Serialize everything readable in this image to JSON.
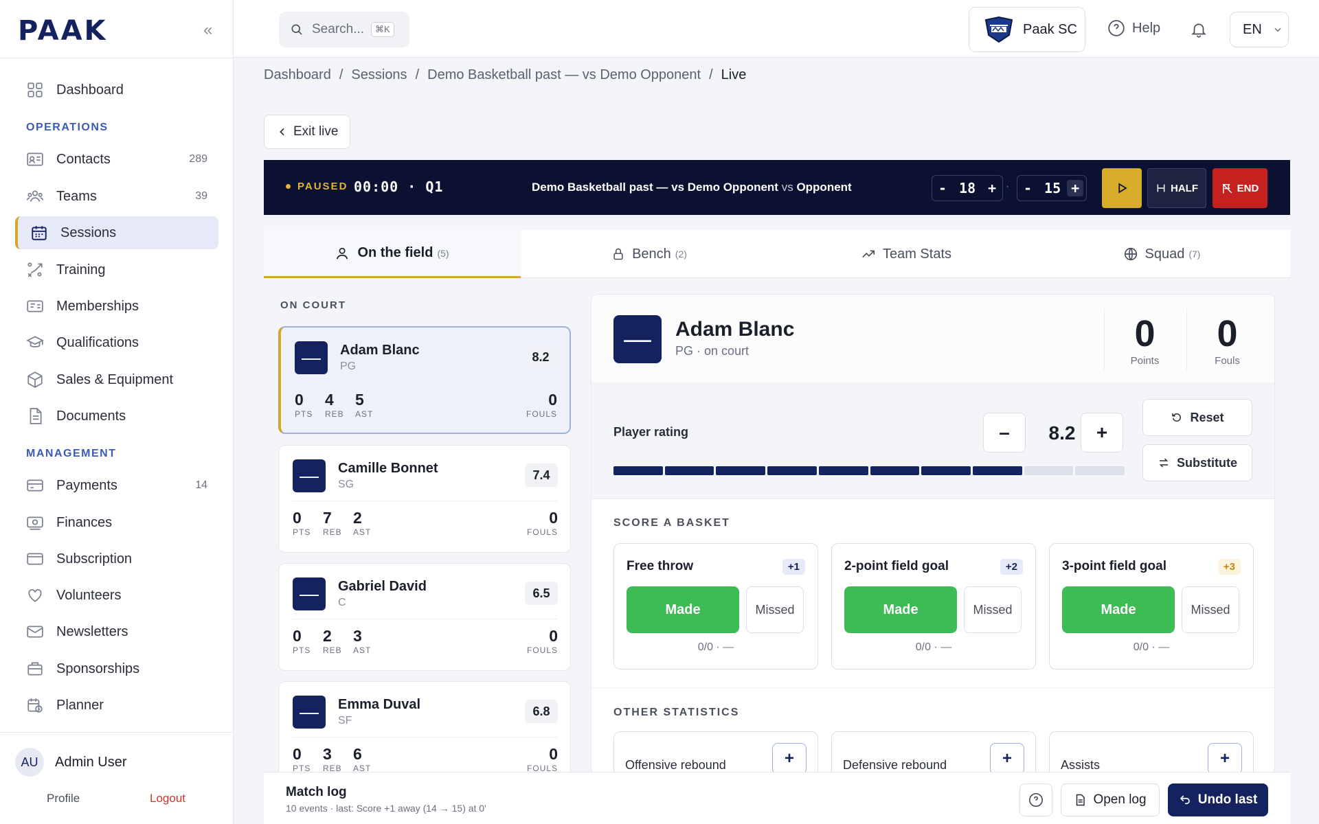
{
  "brand": {
    "logo": "PAAK",
    "accent": "#d6a52a",
    "navy": "#14235f"
  },
  "sidebar": {
    "collapse_label": "«",
    "items": [
      {
        "label": "Dashboard",
        "count": ""
      },
      {
        "label": "Contacts",
        "count": "289"
      },
      {
        "label": "Teams",
        "count": "39"
      },
      {
        "label": "Sessions",
        "count": ""
      },
      {
        "label": "Training",
        "count": ""
      },
      {
        "label": "Memberships",
        "count": ""
      },
      {
        "label": "Qualifications",
        "count": ""
      },
      {
        "label": "Sales & Equipment",
        "count": ""
      },
      {
        "label": "Documents",
        "count": ""
      },
      {
        "label": "Payments",
        "count": "14"
      },
      {
        "label": "Finances",
        "count": ""
      },
      {
        "label": "Subscription",
        "count": ""
      },
      {
        "label": "Volunteers",
        "count": ""
      },
      {
        "label": "Newsletters",
        "count": ""
      },
      {
        "label": "Sponsorships",
        "count": ""
      },
      {
        "label": "Planner",
        "count": ""
      }
    ],
    "section_operations": "OPERATIONS",
    "section_management": "MANAGEMENT",
    "user": {
      "initials": "AU",
      "name": "Admin User",
      "profile": "Profile",
      "logout": "Logout"
    }
  },
  "topbar": {
    "search_placeholder": "Search...",
    "search_kbd": "⌘K",
    "club": "Paak SC",
    "help": "Help",
    "lang": "EN"
  },
  "breadcrumbs": [
    "Dashboard",
    "/",
    "Sessions",
    "/",
    "Demo Basketball past — vs Demo Opponent",
    "/",
    "Live"
  ],
  "exit_label": "Exit live",
  "live": {
    "status": "PAUSED",
    "clock": "00:00 · Q1",
    "match_title": "Demo Basketball past — vs Demo Opponent",
    "vs": "vs",
    "opponent": "Opponent",
    "home_score": "18",
    "away_score": "15",
    "minus": "-",
    "plus": "+",
    "dot": "·",
    "half_label": "HALF",
    "end_label": "END"
  },
  "tabs": [
    {
      "label": "On the field",
      "count": "(5)"
    },
    {
      "label": "Bench",
      "count": "(2)"
    },
    {
      "label": "Team Stats",
      "count": ""
    },
    {
      "label": "Squad",
      "count": "(7)"
    }
  ],
  "on_court_label": "ON COURT",
  "stat_labels": {
    "pts": "PTS",
    "reb": "REB",
    "ast": "AST",
    "fouls": "FOULS"
  },
  "players": [
    {
      "jersey": "—",
      "name": "Adam Blanc",
      "pos": "PG",
      "rating": "8.2",
      "pts": "0",
      "reb": "4",
      "ast": "5",
      "fouls": "0"
    },
    {
      "jersey": "—",
      "name": "Camille Bonnet",
      "pos": "SG",
      "rating": "7.4",
      "pts": "0",
      "reb": "7",
      "ast": "2",
      "fouls": "0"
    },
    {
      "jersey": "—",
      "name": "Gabriel David",
      "pos": "C",
      "rating": "6.5",
      "pts": "0",
      "reb": "2",
      "ast": "3",
      "fouls": "0"
    },
    {
      "jersey": "—",
      "name": "Emma Duval",
      "pos": "SF",
      "rating": "6.8",
      "pts": "0",
      "reb": "3",
      "ast": "6",
      "fouls": "0"
    }
  ],
  "detail": {
    "jersey": "—",
    "name": "Adam Blanc",
    "sub": "PG · on court",
    "points": "0",
    "points_label": "Points",
    "fouls": "0",
    "fouls_label": "Fouls",
    "rating_label": "Player rating",
    "rating": "8.2",
    "rating_minus": "–",
    "rating_plus": "+",
    "rating_fraction": 0.82,
    "reset": "Reset",
    "substitute": "Substitute",
    "score_section": "SCORE A BASKET",
    "shots": [
      {
        "title": "Free throw",
        "bonus": "+1",
        "made": "Made",
        "missed": "Missed",
        "pct": "0/0 · —"
      },
      {
        "title": "2-point field goal",
        "bonus": "+2",
        "made": "Made",
        "missed": "Missed",
        "pct": "0/0 · —"
      },
      {
        "title": "3-point field goal",
        "bonus": "+3",
        "made": "Made",
        "missed": "Missed",
        "pct": "0/0 · —"
      }
    ],
    "other_section": "OTHER STATISTICS",
    "other": [
      {
        "title": "Offensive rebound",
        "plus": "+"
      },
      {
        "title": "Defensive rebound",
        "plus": "+"
      },
      {
        "title": "Assists",
        "plus": "+"
      }
    ]
  },
  "footer": {
    "title": "Match log",
    "sub": "10 events · last: Score +1 away (14 → 15) at 0'",
    "open_log": "Open log",
    "undo": "Undo last"
  }
}
